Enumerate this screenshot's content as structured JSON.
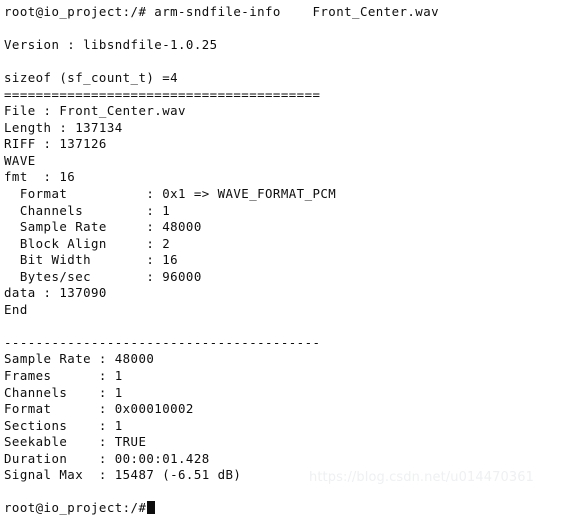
{
  "terminal": {
    "prompt": "root@io_project:/#",
    "command_line": "root@io_project:/# arm-sndfile-info    Front_Center.wav",
    "command": "arm-sndfile-info",
    "argument": "Front_Center.wav",
    "text_color": "#0d0d0d",
    "background_color": "#ffffff",
    "cursor": "block-cursor",
    "lines": [
      "root@io_project:/# arm-sndfile-info    Front_Center.wav",
      "",
      "Version : libsndfile-1.0.25",
      "",
      "sizeof (sf_count_t) =4",
      "========================================",
      "File : Front_Center.wav",
      "Length : 137134",
      "RIFF : 137126",
      "WAVE",
      "fmt  : 16",
      "  Format          : 0x1 => WAVE_FORMAT_PCM",
      "  Channels        : 1",
      "  Sample Rate     : 48000",
      "  Block Align     : 2",
      "  Bit Width       : 16",
      "  Bytes/sec       : 96000",
      "data : 137090",
      "End",
      "",
      "----------------------------------------",
      "Sample Rate : 48000",
      "Frames      : 1",
      "Channels    : 1",
      "Format      : 0x00010002",
      "Sections    : 1",
      "Seekable    : TRUE",
      "Duration    : 00:00:01.428",
      "Signal Max  : 15487 (-6.51 dB)",
      ""
    ],
    "header": {
      "version_label": "Version",
      "version_value": "libsndfile-1.0.25",
      "sizeof_line": "sizeof (sf_count_t) =4",
      "equals_separator": "========================================",
      "dash_separator": "----------------------------------------"
    },
    "riff_chunk": {
      "file_label": "File",
      "file_value": "Front_Center.wav",
      "length_label": "Length",
      "length_value": "137134",
      "riff_label": "RIFF",
      "riff_value": "137126",
      "wave_label": "WAVE",
      "fmt_label": "fmt",
      "fmt_value": "16",
      "format_label": "Format",
      "format_value": "0x1 => WAVE_FORMAT_PCM",
      "channels_label": "Channels",
      "channels_value": "1",
      "sample_rate_label": "Sample Rate",
      "sample_rate_value": "48000",
      "block_align_label": "Block Align",
      "block_align_value": "2",
      "bit_width_label": "Bit Width",
      "bit_width_value": "16",
      "bytes_sec_label": "Bytes/sec",
      "bytes_sec_value": "96000",
      "data_label": "data",
      "data_value": "137090",
      "end_label": "End"
    },
    "summary": {
      "sample_rate_label": "Sample Rate",
      "sample_rate_value": "48000",
      "frames_label": "Frames",
      "frames_value": "1",
      "channels_label": "Channels",
      "channels_value": "1",
      "format_label": "Format",
      "format_value": "0x00010002",
      "sections_label": "Sections",
      "sections_value": "1",
      "seekable_label": "Seekable",
      "seekable_value": "TRUE",
      "duration_label": "Duration",
      "duration_value": "00:00:01.428",
      "signal_max_label": "Signal Max",
      "signal_max_value": "15487 (-6.51 dB)"
    }
  },
  "watermark": {
    "text": "https://blog.csdn.net/u014470361",
    "color": "#eef0f2"
  }
}
